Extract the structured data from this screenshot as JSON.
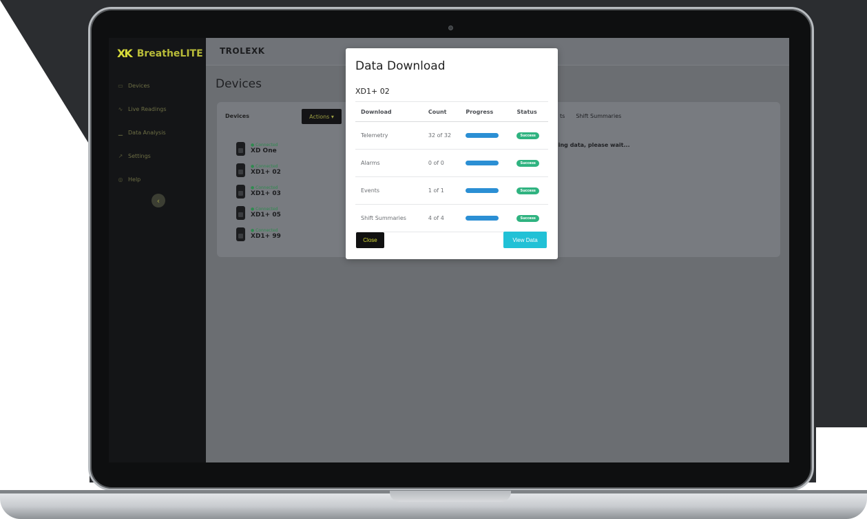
{
  "app": {
    "brand": "BreatheLITE",
    "brand_mark": "XK",
    "logo": "TROLEXK"
  },
  "sidebar": {
    "items": [
      {
        "label": "Devices",
        "icon": "device-icon"
      },
      {
        "label": "Live Readings",
        "icon": "pulse-icon"
      },
      {
        "label": "Data Analysis",
        "icon": "chart-icon"
      },
      {
        "label": "Settings",
        "icon": "wrench-icon"
      },
      {
        "label": "Help",
        "icon": "help-icon"
      }
    ],
    "collapse_icon": "‹"
  },
  "main": {
    "page_title": "Devices",
    "card_title": "Devices",
    "actions_label": "Actions ▾",
    "tabs_right": [
      "ts",
      "Shift Summaries"
    ],
    "waiting_text": "ling data, please wait...",
    "devices": [
      {
        "status": "● Connected",
        "name": "XD One"
      },
      {
        "status": "● Connected",
        "name": "XD1+ 02"
      },
      {
        "status": "● Connected",
        "name": "XD1+ 03"
      },
      {
        "status": "● Connected",
        "name": "XD1+ 05"
      },
      {
        "status": "● Connected",
        "name": "XD1+ 99"
      }
    ]
  },
  "modal": {
    "title": "Data Download",
    "device": "XD1+ 02",
    "columns": [
      "Download",
      "Count",
      "Progress",
      "Status"
    ],
    "rows": [
      {
        "download": "Telemetry",
        "count": "32 of 32",
        "progress": 1.0,
        "status": "Success"
      },
      {
        "download": "Alarms",
        "count": "0 of 0",
        "progress": 1.0,
        "status": "Success"
      },
      {
        "download": "Events",
        "count": "1 of 1",
        "progress": 1.0,
        "status": "Success"
      },
      {
        "download": "Shift Summaries",
        "count": "4 of 4",
        "progress": 1.0,
        "status": "Success"
      }
    ],
    "close_label": "Close",
    "view_label": "View Data"
  },
  "colors": {
    "accent": "#d8dc3b",
    "progress": "#2b8fd4",
    "success": "#2fb380",
    "view_button": "#21c1d6"
  }
}
